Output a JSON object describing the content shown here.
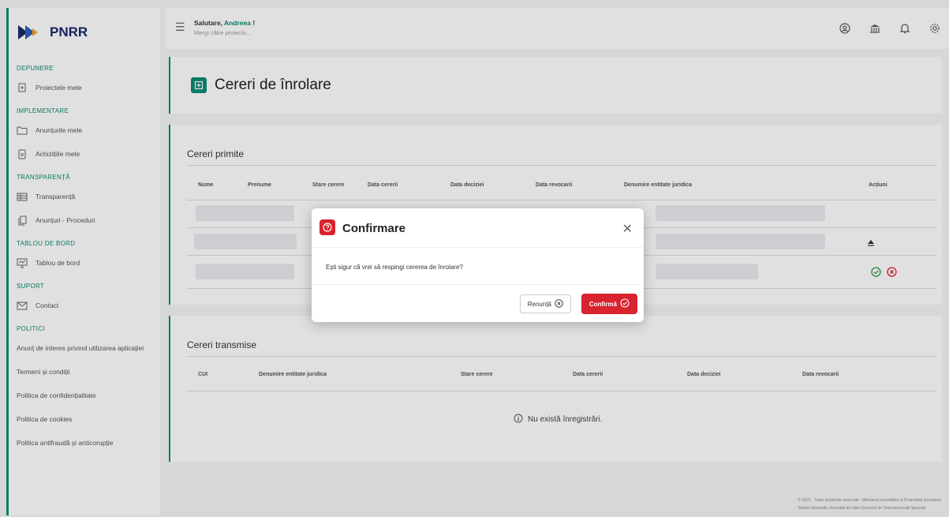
{
  "brand": {
    "name": "PNRR"
  },
  "sidebar": {
    "sections": [
      {
        "title": "DEPUNERE",
        "items": [
          {
            "label": "Proiectele mele",
            "icon": "projects-icon"
          }
        ]
      },
      {
        "title": "IMPLEMENTARE",
        "items": [
          {
            "label": "Anunțurile mele",
            "icon": "folder-icon"
          },
          {
            "label": "Achizițiile mele",
            "icon": "document-icon"
          }
        ]
      },
      {
        "title": "TRANSPARENȚĂ",
        "items": [
          {
            "label": "Transparență",
            "icon": "table-icon"
          },
          {
            "label": "Anunțuri - Proceduri",
            "icon": "copy-icon"
          }
        ]
      },
      {
        "title": "TABLOU DE BORD",
        "items": [
          {
            "label": "Tablou de bord",
            "icon": "dashboard-icon"
          }
        ]
      },
      {
        "title": "SUPORT",
        "items": [
          {
            "label": "Contact",
            "icon": "mail-icon"
          }
        ]
      },
      {
        "title": "POLITICI",
        "links": [
          "Anunț de interes privind utilizarea aplicației",
          "Termeni și condiții",
          "Politica de confidențialitate",
          "Politica de cookies",
          "Politica antifraudă și anticorupție"
        ]
      }
    ]
  },
  "topbar": {
    "greeting_prefix": "Salutare,",
    "user_name": "Andreea",
    "greeting_suffix": "!",
    "goto_text": "Mergi către proiectv..."
  },
  "page": {
    "title": "Cereri de înrolare"
  },
  "received": {
    "title": "Cereri primite",
    "columns": [
      "Nume",
      "Prenume",
      "Stare cerere",
      "Data cererii",
      "Data deciziei",
      "Data revocarii",
      "Denumire entitate juridica",
      "Acțiuni"
    ]
  },
  "sent": {
    "title": "Cereri transmise",
    "columns": [
      "CUI",
      "Denumire entitate juridica",
      "Stare cerere",
      "Data cererii",
      "Data deciziei",
      "Data revocarii"
    ],
    "empty_message": "Nu există înregistrări."
  },
  "footer": {
    "line1": "© 2022 - Toate drepturile rezervate - Ministerul Investițiilor și Proiectelor Europene",
    "line2": "Sistem informatic dezvoltat de către Serviciul de Telecomunicații Speciale"
  },
  "modal": {
    "title": "Confirmare",
    "message": "Ești sigur că vrei să respingi cererea de înrolare?",
    "cancel_label": "Renunță",
    "confirm_label": "Confirmă"
  },
  "colors": {
    "accent": "#0d8a72",
    "danger": "#d9232e",
    "brand": "#1a2a6c"
  }
}
